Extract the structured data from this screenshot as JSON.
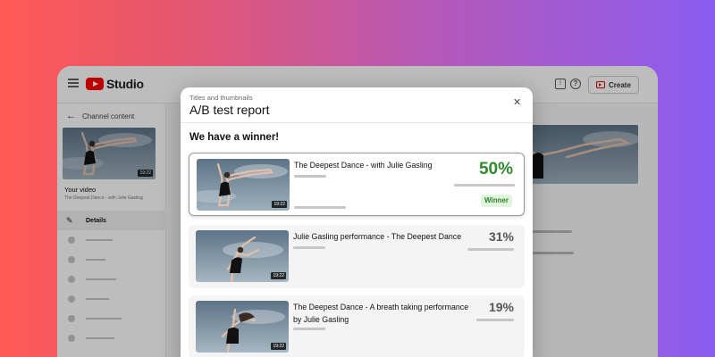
{
  "app": {
    "name": "Studio",
    "brand_color": "#ff0000",
    "create_label": "Create"
  },
  "sidebar": {
    "back_label": "Channel content",
    "your_video_label": "Your video",
    "video_subtitle": "The Deepest Dance - with Julie Gasling",
    "thumbnail_duration": "19:22",
    "active_item": "Details"
  },
  "dialog": {
    "overline": "Titles and thumbnails",
    "title": "A/B test report",
    "heading": "We have a winner!",
    "results": [
      {
        "title": "The Deepest Dance - with Julie Gasling",
        "percent": "50%",
        "badge": "Winner",
        "duration": "19:22",
        "accent": "#2e8b2e"
      },
      {
        "title": "Julie Gasling performance - The Deepest Dance",
        "percent": "31%",
        "duration": "19:22"
      },
      {
        "title": "The Deepest Dance - A breath taking performance by Julie Gasling",
        "percent": "19%",
        "duration": "19:22"
      }
    ]
  },
  "icons": [
    "menu-icon",
    "youtube-logo-icon",
    "feedback-icon",
    "help-icon",
    "create-video-icon",
    "back-arrow-icon",
    "pencil-icon",
    "close-icon"
  ]
}
